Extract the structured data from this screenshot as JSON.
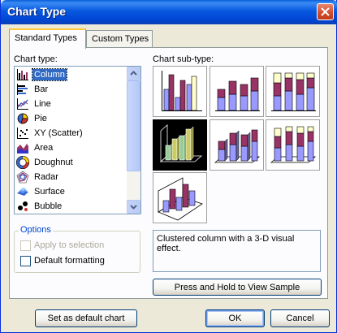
{
  "window": {
    "title": "Chart Type"
  },
  "tabs": [
    {
      "label": "Standard Types"
    },
    {
      "label": "Custom Types"
    }
  ],
  "chart_type": {
    "label": "Chart type:",
    "items": [
      {
        "label": "Column",
        "icon": "column-chart-icon"
      },
      {
        "label": "Bar",
        "icon": "bar-chart-icon"
      },
      {
        "label": "Line",
        "icon": "line-chart-icon"
      },
      {
        "label": "Pie",
        "icon": "pie-chart-icon"
      },
      {
        "label": "XY (Scatter)",
        "icon": "scatter-chart-icon"
      },
      {
        "label": "Area",
        "icon": "area-chart-icon"
      },
      {
        "label": "Doughnut",
        "icon": "doughnut-chart-icon"
      },
      {
        "label": "Radar",
        "icon": "radar-chart-icon"
      },
      {
        "label": "Surface",
        "icon": "surface-chart-icon"
      },
      {
        "label": "Bubble",
        "icon": "bubble-chart-icon"
      }
    ],
    "selected": "Column"
  },
  "sub_type": {
    "label": "Chart sub-type:",
    "description": "Clustered column with a 3-D visual effect."
  },
  "options": {
    "title": "Options",
    "apply_to_selection": "Apply to selection",
    "default_formatting": "Default formatting"
  },
  "buttons": {
    "view_sample": "Press and Hold to View Sample",
    "set_default": "Set as default chart",
    "ok": "OK",
    "cancel": "Cancel"
  },
  "colors": {
    "bar_purple": "#993366",
    "bar_lavender": "#9999ff",
    "bar_cream": "#ffffcc",
    "selected_bg": "#316ac5",
    "titlebar": "#0054e3"
  }
}
